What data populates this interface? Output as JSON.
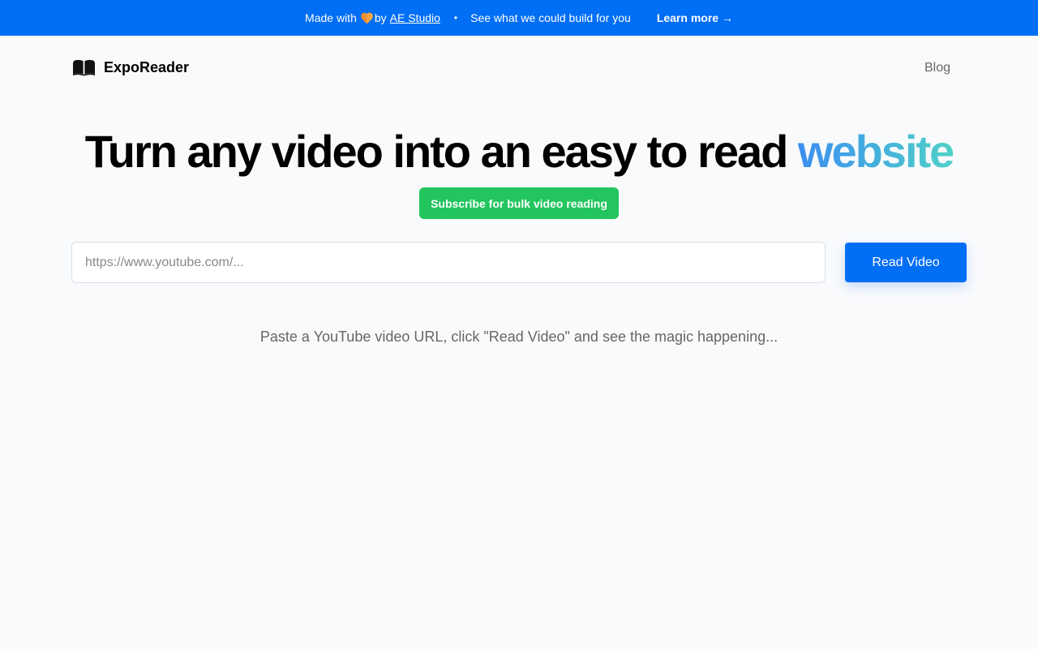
{
  "banner": {
    "made_with": "Made with",
    "heart_icon": "orange-heart",
    "by": "by",
    "studio_link": "AE Studio",
    "separator": "•",
    "pitch": "See what we could build for you",
    "learn_more": "Learn more →",
    "background_color": "#006ef5"
  },
  "header": {
    "logo_icon": "open-book-icon",
    "brand_name": "ExpoReader",
    "nav": {
      "blog": "Blog"
    }
  },
  "hero": {
    "title_prefix": "Turn any video into an easy to read",
    "title_accent": "website",
    "subscribe_label": "Subscribe for bulk video reading",
    "subscribe_color": "#22c55e"
  },
  "search": {
    "placeholder": "https://www.youtube.com/...",
    "value": "",
    "button_label": "Read Video",
    "button_color": "#006ef5"
  },
  "hint": {
    "text": "Paste a YouTube video URL, click \"Read Video\" and see the magic happening..."
  }
}
